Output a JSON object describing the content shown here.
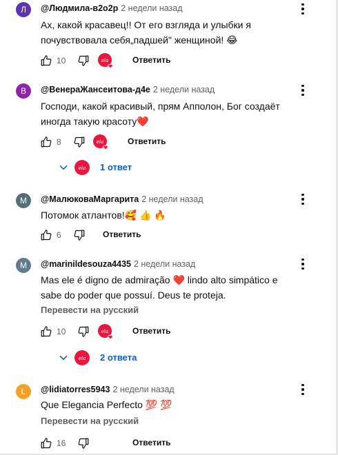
{
  "colors": {
    "accent": "#065fd4",
    "secondary_text": "#606060",
    "badge": "#e8173d"
  },
  "comments": [
    {
      "avatar_letter": "Л",
      "avatar_color": "#5e35b1",
      "author": "@Людмила-в2о2р",
      "time": "2 недели назад",
      "text": "Ах, какой красавец!! От его взгляда и улыбки я почувствовала себя„падшей\" женщиной! 😂",
      "likes": "10",
      "reply_label": "Ответить"
    },
    {
      "avatar_letter": "В",
      "avatar_color": "#8e24aa",
      "author": "@ВенераЖансеитова-д4е",
      "time": "2 недели назад",
      "text": "Господи, какой красивый, прям Апполон, Бог создаёт иногда такую красоту❤️",
      "likes": "8",
      "reply_label": "Ответить",
      "replies_label": "1 ответ"
    },
    {
      "avatar_letter": "М",
      "avatar_color": "#546e7a",
      "author": "@МалюковаМаргарита",
      "time": "2 недели назад",
      "text": "Потомок атлантов!🥰 👍 🔥",
      "likes": "6",
      "reply_label": "Ответить"
    },
    {
      "avatar_letter": "M",
      "avatar_color": "#607d8b",
      "author": "@marinildesouza4435",
      "time": "2 недели назад",
      "text": "Mas ele é digno de admiração ❤️ lindo alto simpático e sabe do poder que possuí. Deus te proteja.",
      "translate_label": "Перевести на русский",
      "likes": "10",
      "reply_label": "Ответить",
      "replies_label": "2 ответа"
    },
    {
      "avatar_letter": "L",
      "avatar_color": "#f4a025",
      "author": "@lidiatorres5943",
      "time": "2 недели назад",
      "text": "Que Elegancia Perfecto 💯 💯",
      "translate_label": "Перевести на русский",
      "likes": "16",
      "reply_label": "Ответить"
    }
  ]
}
